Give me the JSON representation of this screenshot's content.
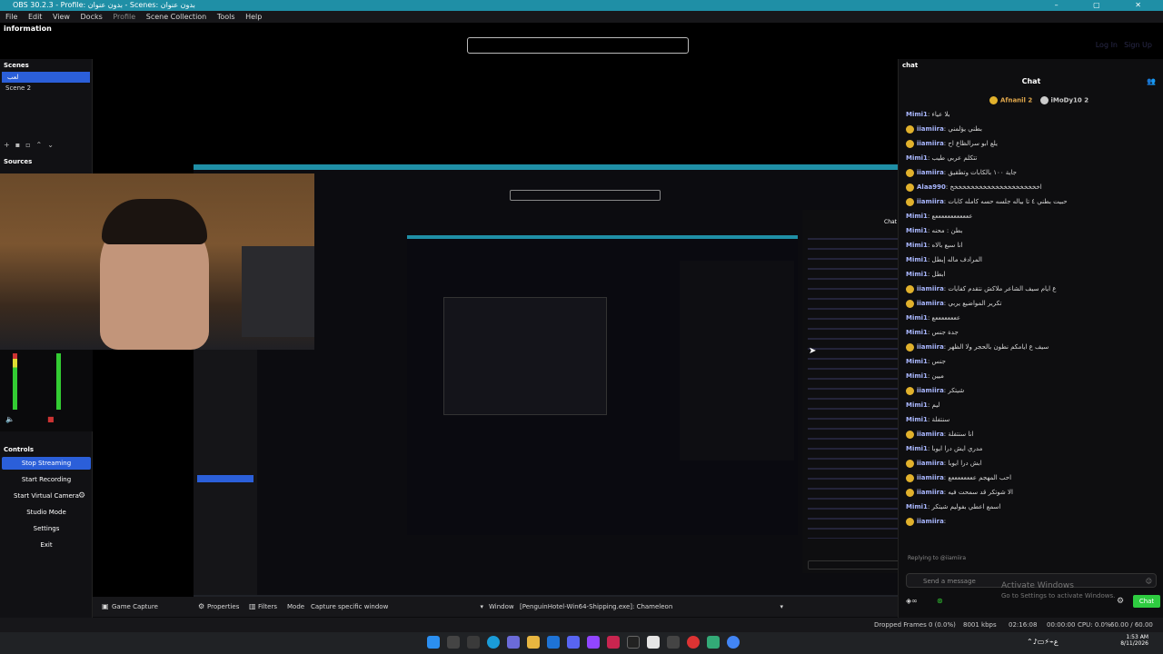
{
  "window": {
    "title": "OBS 30.2.3 - Profile: بدون عنوان - Scenes: بدون عنوان",
    "controls": "– ▢ ✕"
  },
  "menu": [
    "File",
    "Edit",
    "View",
    "Docks",
    "Profile",
    "Scene Collection",
    "Tools",
    "Help"
  ],
  "info_dock": {
    "title": "information",
    "login": "Log In",
    "signup": "Sign Up"
  },
  "scenes": {
    "title": "Scenes",
    "items": [
      "لعب",
      "Scene 2"
    ],
    "selected_index": 0
  },
  "sources": {
    "title": "Sources"
  },
  "controls": {
    "title": "Controls",
    "buttons": [
      "Stop Streaming",
      "Start Recording",
      "Start Virtual Camera",
      "Studio Mode",
      "Settings",
      "Exit"
    ],
    "active_index": 0
  },
  "source_toolbar": {
    "source": "Game Capture",
    "properties": "Properties",
    "filters": "Filters",
    "mode_label": "Mode",
    "mode_value": "Capture specific window",
    "window_label": "Window",
    "window_value": "[PenguinHotel-Win64-Shipping.exe]: Chameleon"
  },
  "chat": {
    "dock_title": "chat",
    "title": "Chat",
    "top_chatters": [
      "Afnanil 2",
      "iMoDy10 2"
    ],
    "messages": [
      {
        "user": "Mimi1",
        "text": "بلا عياء"
      },
      {
        "user": "iiamiira",
        "text": "بطني يؤلمني",
        "badge": true
      },
      {
        "user": "iiamiira",
        "text": "يلع ابو سرالظاع اح",
        "badge": true
      },
      {
        "user": "Mimi1",
        "text": "تتكلم عربي طيب"
      },
      {
        "user": "iiamiira",
        "text": "جاية ١٠٠ بالكابات وتطقيق",
        "badge": true
      },
      {
        "user": "Alaa990",
        "text": "اخخخخخخخخخخخخخخخخخخخخخخ",
        "badge": true
      },
      {
        "user": "iiamiira",
        "text": "حبيت بطني ٤ تا بياله جلسه حسه كامله كابات",
        "badge": true
      },
      {
        "user": "Mimi1",
        "text": "ععععععععععععع"
      },
      {
        "user": "Mimi1",
        "text": "بطن : محنه"
      },
      {
        "user": "Mimi1",
        "text": "انا سبع بالاه"
      },
      {
        "user": "Mimi1",
        "text": "المرادف ماله إبطل"
      },
      {
        "user": "Mimi1",
        "text": "ابطل"
      },
      {
        "user": "iiamiira",
        "text": "ع ايام سيف الشاعر ملاكش نتقدم كفايات",
        "badge": true
      },
      {
        "user": "iiamiira",
        "text": "تكرير المواضيع يربي",
        "badge": true
      },
      {
        "user": "Mimi1",
        "text": "ععععععععع"
      },
      {
        "user": "Mimi1",
        "text": "جدة جنس"
      },
      {
        "user": "iiamiira",
        "text": "سيف ع ايامكم نطون بالحجر ولا الظهر",
        "badge": true
      },
      {
        "user": "Mimi1",
        "text": "جنس"
      },
      {
        "user": "Mimi1",
        "text": "ميين"
      },
      {
        "user": "iiamiira",
        "text": "شيتكر",
        "badge": true
      },
      {
        "user": "Mimi1",
        "text": "ليم"
      },
      {
        "user": "Mimi1",
        "text": "سنتفلة"
      },
      {
        "user": "iiamiira",
        "text": "انا سنتفلة",
        "badge": true
      },
      {
        "user": "Mimi1",
        "text": "مدري ايش درا ايوبا"
      },
      {
        "user": "iiamiira",
        "text": "ابش درا ايوبا",
        "badge": true
      },
      {
        "user": "iiamiira",
        "text": "احب المهجم ععععععععع",
        "badge": true
      },
      {
        "user": "iiamiira",
        "text": "الا شوتكر قد سمحت فيه",
        "badge": true
      },
      {
        "user": "Mimi1",
        "text": "اسمع اعطي بفوليم شيتكر"
      },
      {
        "user": "iiamiira",
        "text": "",
        "badge": true
      }
    ],
    "reply_to": "Replying to @iiamiira",
    "input_placeholder": "Send a message",
    "chat_button": "Chat"
  },
  "watermark": {
    "line1": "Activate Windows",
    "line2": "Go to Settings to activate Windows."
  },
  "status": {
    "dropped": "Dropped Frames 0 (0.0%)",
    "bitrate": "8001 kbps",
    "live_time": "02:16:08",
    "rec_time": "00:00:00",
    "cpu": "CPU: 0.0%",
    "fps": "60.00 / 60.00 FPS"
  },
  "clock": {
    "time": "1:53 AM",
    "date": "8/11/2026"
  }
}
